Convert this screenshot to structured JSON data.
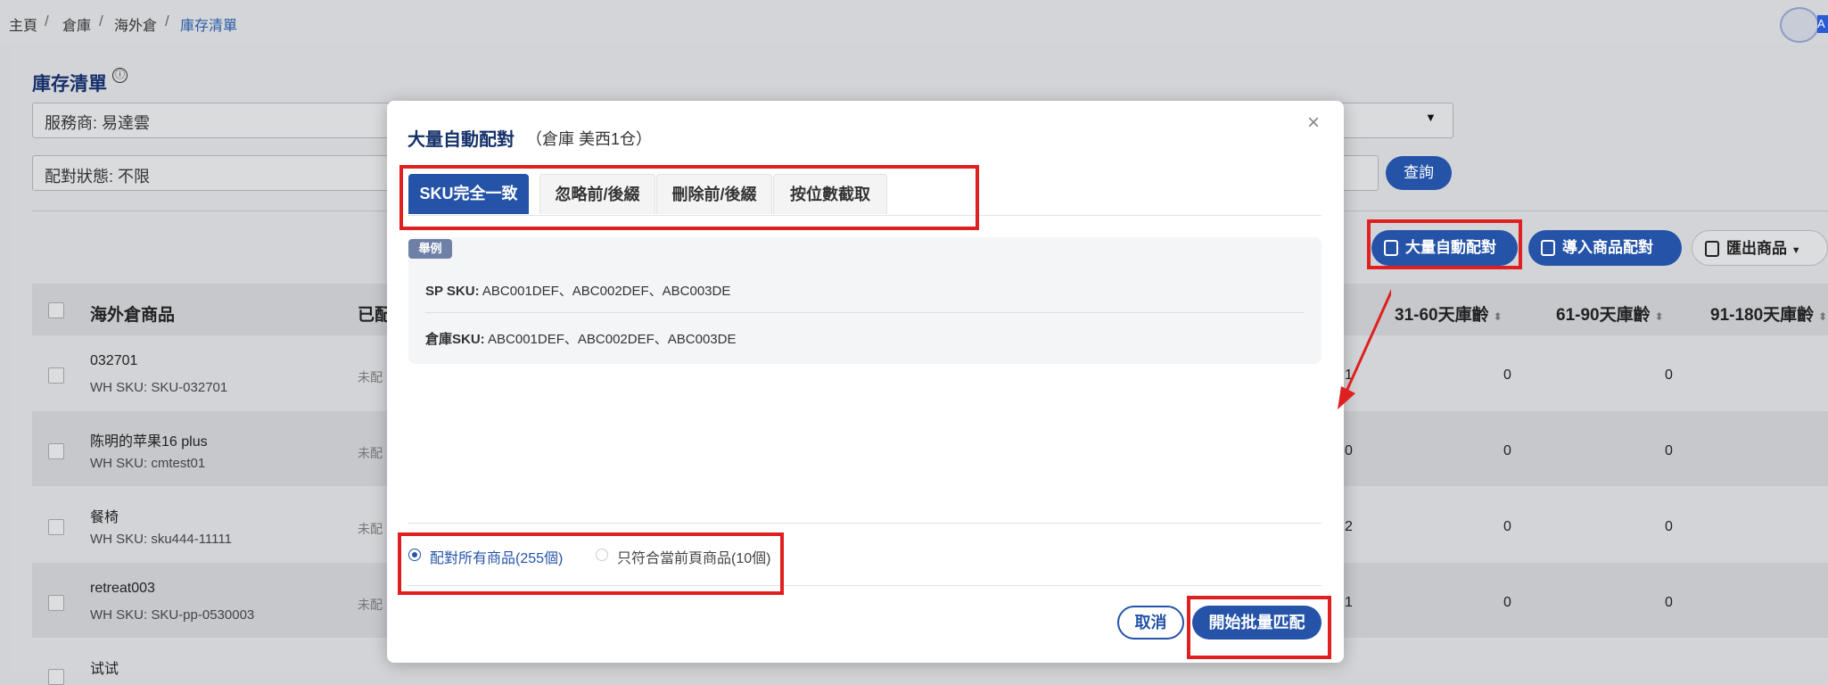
{
  "breadcrumb": [
    "主頁",
    "倉庫",
    "海外倉",
    "庫存清單"
  ],
  "breadcrumb_separator": "/",
  "avatar_label": "A",
  "page": {
    "title": "庫存清單",
    "info_icon": "ⓘ",
    "provider_select": "服務商: 易達雲",
    "match_status_filter": "配對狀態: 不限",
    "query_button": "查詢"
  },
  "toolbar": {
    "bulk_auto_match": "大量自動配對",
    "import_match": "導入商品配對",
    "export_products": "匯出商品"
  },
  "table": {
    "col_product": "海外倉商品",
    "col_matched": "已配",
    "col_age_31_60": "31-60天庫齡",
    "col_age_61_90": "61-90天庫齡",
    "col_age_91_180": "91-180天庫齡",
    "rows": [
      {
        "name": "032701",
        "sku": "WH SKU: SKU-032701",
        "status": "未配",
        "partial": "1",
        "age31": "0",
        "age61": "0"
      },
      {
        "name": "陈明的苹果16 plus",
        "sku": "WH SKU: cmtest01",
        "status": "未配",
        "partial": "0",
        "age31": "0",
        "age61": "0"
      },
      {
        "name": "餐椅",
        "sku": "WH SKU: sku444-11111",
        "status": "未配",
        "partial": "2",
        "age31": "0",
        "age61": "0"
      },
      {
        "name": "retreat003",
        "sku": "WH SKU: SKU-pp-0530003",
        "status": "未配",
        "partial": "1",
        "age31": "0",
        "age61": "0"
      },
      {
        "name": "试试",
        "sku": "",
        "status": "",
        "partial": "",
        "age31": "",
        "age61": ""
      }
    ]
  },
  "modal": {
    "title": "大量自動配對",
    "subtitle": "（倉庫 美西1仓）",
    "close": "×",
    "tabs": [
      "SKU完全一致",
      "忽略前/後綴",
      "刪除前/後綴",
      "按位數截取"
    ],
    "example": {
      "badge": "舉例",
      "sp_label": "SP SKU:",
      "sp_value": "ABC001DEF、ABC002DEF、ABC003DE",
      "wh_label": "倉庫SKU:",
      "wh_value": "ABC001DEF、ABC002DEF、ABC003DE"
    },
    "scope_all": "配對所有商品(255個)",
    "scope_page": "只符合當前頁商品(10個)",
    "cancel": "取消",
    "start": "開始批量匹配"
  },
  "colors": {
    "primary": "#2453a8",
    "title": "#15306a",
    "annotation": "#e02020"
  },
  "icons": [
    "info-icon",
    "caret-down-icon",
    "bulk-match-icon",
    "import-icon",
    "export-icon",
    "close-icon",
    "sort-icon",
    "radio-icon"
  ]
}
